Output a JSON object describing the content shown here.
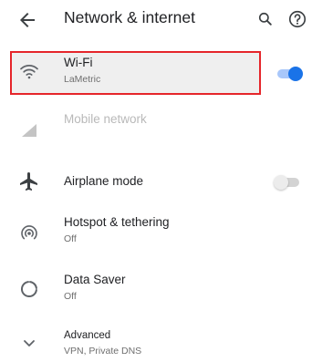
{
  "header": {
    "title": "Network & internet",
    "back_icon": "arrow-back-icon",
    "search_icon": "search-icon",
    "help_icon": "help-icon"
  },
  "items": [
    {
      "id": "wifi",
      "title": "Wi-Fi",
      "subtitle": "LaMetric",
      "icon": "wifi-icon",
      "toggle": "on",
      "highlighted": true
    },
    {
      "id": "mobile",
      "title": "Mobile network",
      "icon": "signal-icon",
      "disabled": true
    },
    {
      "id": "airplane",
      "title": "Airplane mode",
      "icon": "airplane-icon",
      "toggle": "off"
    },
    {
      "id": "hotspot",
      "title": "Hotspot & tethering",
      "subtitle": "Off",
      "icon": "hotspot-icon"
    },
    {
      "id": "datasaver",
      "title": "Data Saver",
      "subtitle": "Off",
      "icon": "data-saver-icon"
    },
    {
      "id": "advanced",
      "title": "Advanced",
      "subtitle": "VPN, Private DNS",
      "icon": "chevron-down-icon"
    }
  ],
  "colors": {
    "accent": "#1a73e8",
    "highlight_border": "#e5252a",
    "icon": "#5f6368"
  }
}
